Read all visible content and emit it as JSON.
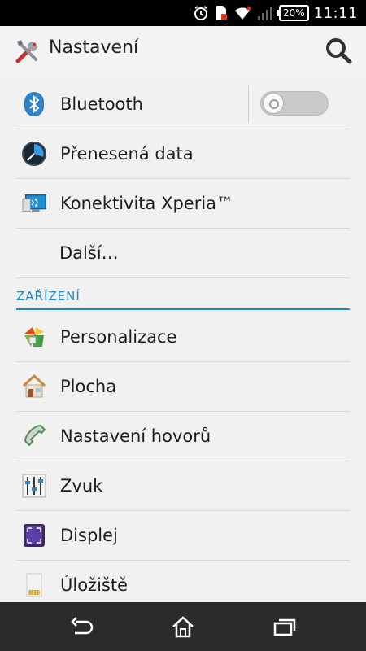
{
  "status_bar": {
    "time": "11:11",
    "battery_percent": "20%",
    "icons": [
      "alarm-icon",
      "sim-icon",
      "wifi-icon",
      "signal-icon",
      "battery-icon"
    ]
  },
  "action_bar": {
    "title": "Nastavení",
    "app_icon": "tools-icon",
    "search_icon": "search-icon"
  },
  "list": {
    "rows": [
      {
        "label": "Bluetooth",
        "icon": "bluetooth-icon",
        "toggle": "off"
      },
      {
        "label": "Přenesená data",
        "icon": "data-usage-icon"
      },
      {
        "label": "Konektivita Xperia™",
        "icon": "xperia-connectivity-icon"
      },
      {
        "label": "Další…"
      }
    ],
    "section_title": "ZAŘÍZENÍ",
    "device_rows": [
      {
        "label": "Personalizace",
        "icon": "personalization-icon"
      },
      {
        "label": "Plocha",
        "icon": "home-screen-icon"
      },
      {
        "label": "Nastavení hovorů",
        "icon": "call-settings-icon"
      },
      {
        "label": "Zvuk",
        "icon": "sound-icon"
      },
      {
        "label": "Displej",
        "icon": "display-icon"
      },
      {
        "label": "Úložiště",
        "icon": "storage-icon"
      }
    ]
  },
  "navigation_bar": {
    "buttons": [
      "back-icon",
      "home-icon",
      "recents-icon"
    ]
  },
  "colors": {
    "accent": "#1f8ac8",
    "background": "#f1f1f1",
    "status_bar": "#000000",
    "nav_bar": "#2b2b2b"
  }
}
